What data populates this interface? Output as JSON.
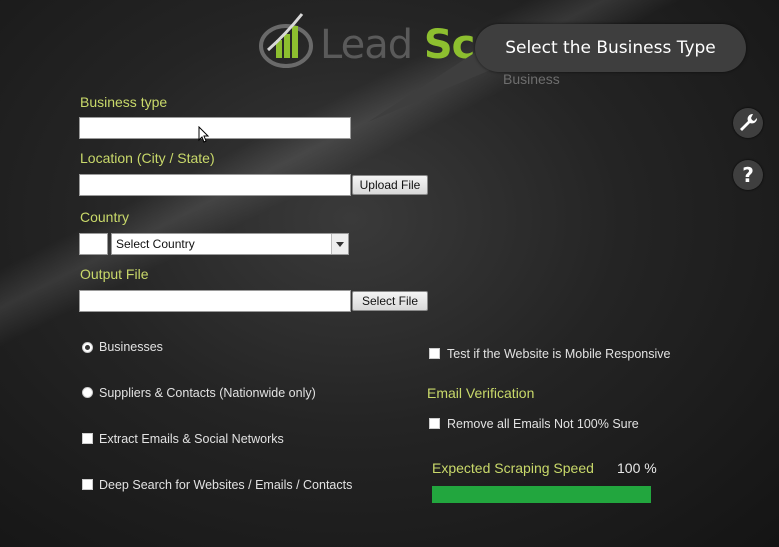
{
  "header": {
    "logo_word1": "Lead",
    "logo_word2": "Sc"
  },
  "tooltip": {
    "text": "Select the Business Type",
    "hint": "Business"
  },
  "form": {
    "business_type_label": "Business type",
    "business_type_value": "",
    "location_label": "Location (City / State)",
    "location_value": "",
    "upload_file_label": "Upload File",
    "country_label": "Country",
    "country_code_value": "",
    "country_select_value": "Select Country",
    "output_file_label": "Output File",
    "output_file_value": "",
    "select_file_label": "Select File"
  },
  "options": {
    "businesses": "Businesses",
    "suppliers": "Suppliers & Contacts (Nationwide only)",
    "extract_emails": "Extract Emails & Social Networks",
    "deep_search": "Deep Search for Websites / Emails / Contacts",
    "mobile_test": "Test if the Website is Mobile Responsive",
    "email_verification_heading": "Email Verification",
    "remove_emails": "Remove all Emails Not 100% Sure",
    "selected_search_mode": "businesses"
  },
  "speed": {
    "label": "Expected Scraping Speed",
    "value_text": "100 %",
    "value": 100
  },
  "icons": {
    "settings": "wrench-icon",
    "help": "help-icon"
  },
  "colors": {
    "label": "#c9d96a",
    "accent": "#8dbf2f",
    "progress": "#22a63e"
  }
}
